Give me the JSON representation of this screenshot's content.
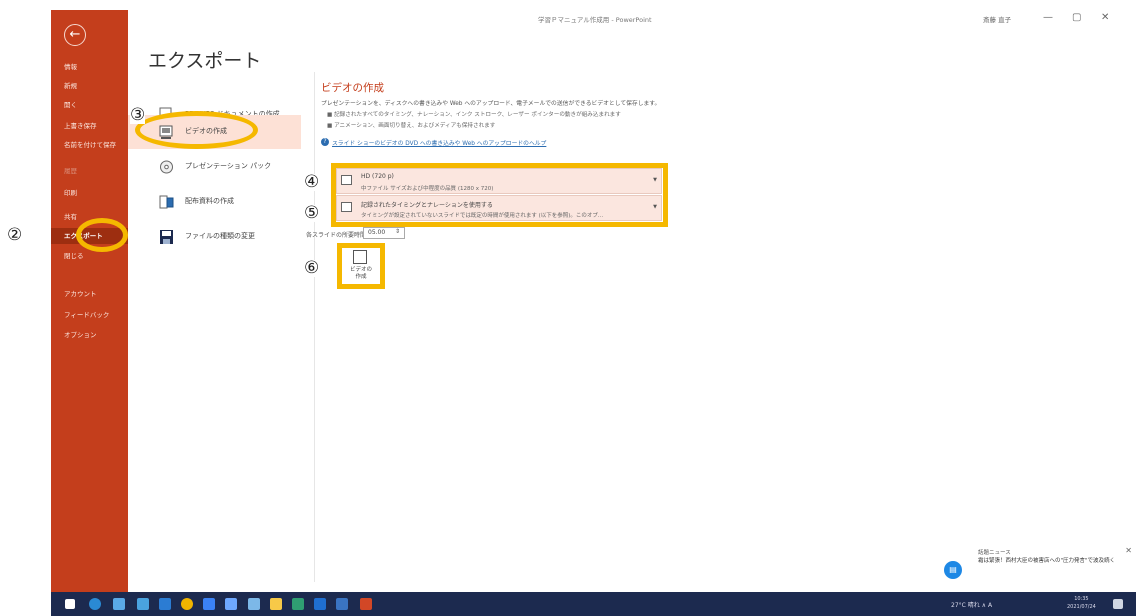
{
  "annotations": {
    "step2": "②",
    "step3": "③",
    "step4": "④",
    "step5": "⑤",
    "step6": "⑥"
  },
  "titlebar": {
    "doc_title": "学習Ｐマニュアル作成用 - PowerPoint",
    "user": "斎藤 直子",
    "minimize": "—",
    "restore": "▢",
    "close": "✕"
  },
  "backstage": {
    "back_icon": "←",
    "items": [
      {
        "label": "情報"
      },
      {
        "label": "新規"
      },
      {
        "label": "開く"
      },
      {
        "label": "上書き保存"
      },
      {
        "label": "名前を付けて保存"
      },
      {
        "label": "履歴"
      },
      {
        "label": "印刷"
      },
      {
        "label": "共有"
      },
      {
        "label": "エクスポート"
      },
      {
        "label": "閉じる"
      },
      {
        "label": "アカウント"
      },
      {
        "label": "フィードバック"
      },
      {
        "label": "オプション"
      }
    ]
  },
  "main": {
    "heading": "エクスポート",
    "options": [
      {
        "label": "PDF/XPS ドキュメントの作成"
      },
      {
        "label": "ビデオの作成"
      },
      {
        "label": "プレゼンテーション パック"
      },
      {
        "label": "配布資料の作成"
      },
      {
        "label": "ファイルの種類の変更"
      }
    ]
  },
  "video_panel": {
    "title": "ビデオの作成",
    "description": "プレゼンテーションを、ディスクへの書き込みや Web へのアップロード、電子メールでの送信ができるビデオとして保存します。",
    "bullets": [
      "記録されたすべてのタイミング、ナレーション、インク ストローク、レーザー ポインターの動きが組み込まれます",
      "アニメーション、画面切り替え、およびメディアも保持されます"
    ],
    "help_link": "スライド ショーのビデオの DVD への書き込みや Web へのアップロードのヘルプ",
    "quality_dropdown": {
      "line1": "HD (720 p)",
      "line2": "中ファイル サイズおよび中程度の品質 (1280 x 720)"
    },
    "timing_dropdown": {
      "line1": "記録されたタイミングとナレーションを使用する",
      "line2": "タイミングが設定されていないスライドでは既定の時間が使用されます (以下を参照)。このオプ..."
    },
    "seconds_label": "各スライドの所要時間 (秒):",
    "seconds_value": "05.00",
    "create_button": "ビデオの\n作成"
  },
  "news": {
    "title": "話題ニュース",
    "body": "霜は緊張！西村大臣の被害店への\"圧力発言\"で波及続く"
  },
  "taskbar": {
    "tray": "27°C 晴れ  ∧  A",
    "time": "10:35\n2021/07/24"
  },
  "colors": {
    "accent": "#c43e1c",
    "highlight": "#f5b800",
    "selected": "#fde1d6"
  }
}
